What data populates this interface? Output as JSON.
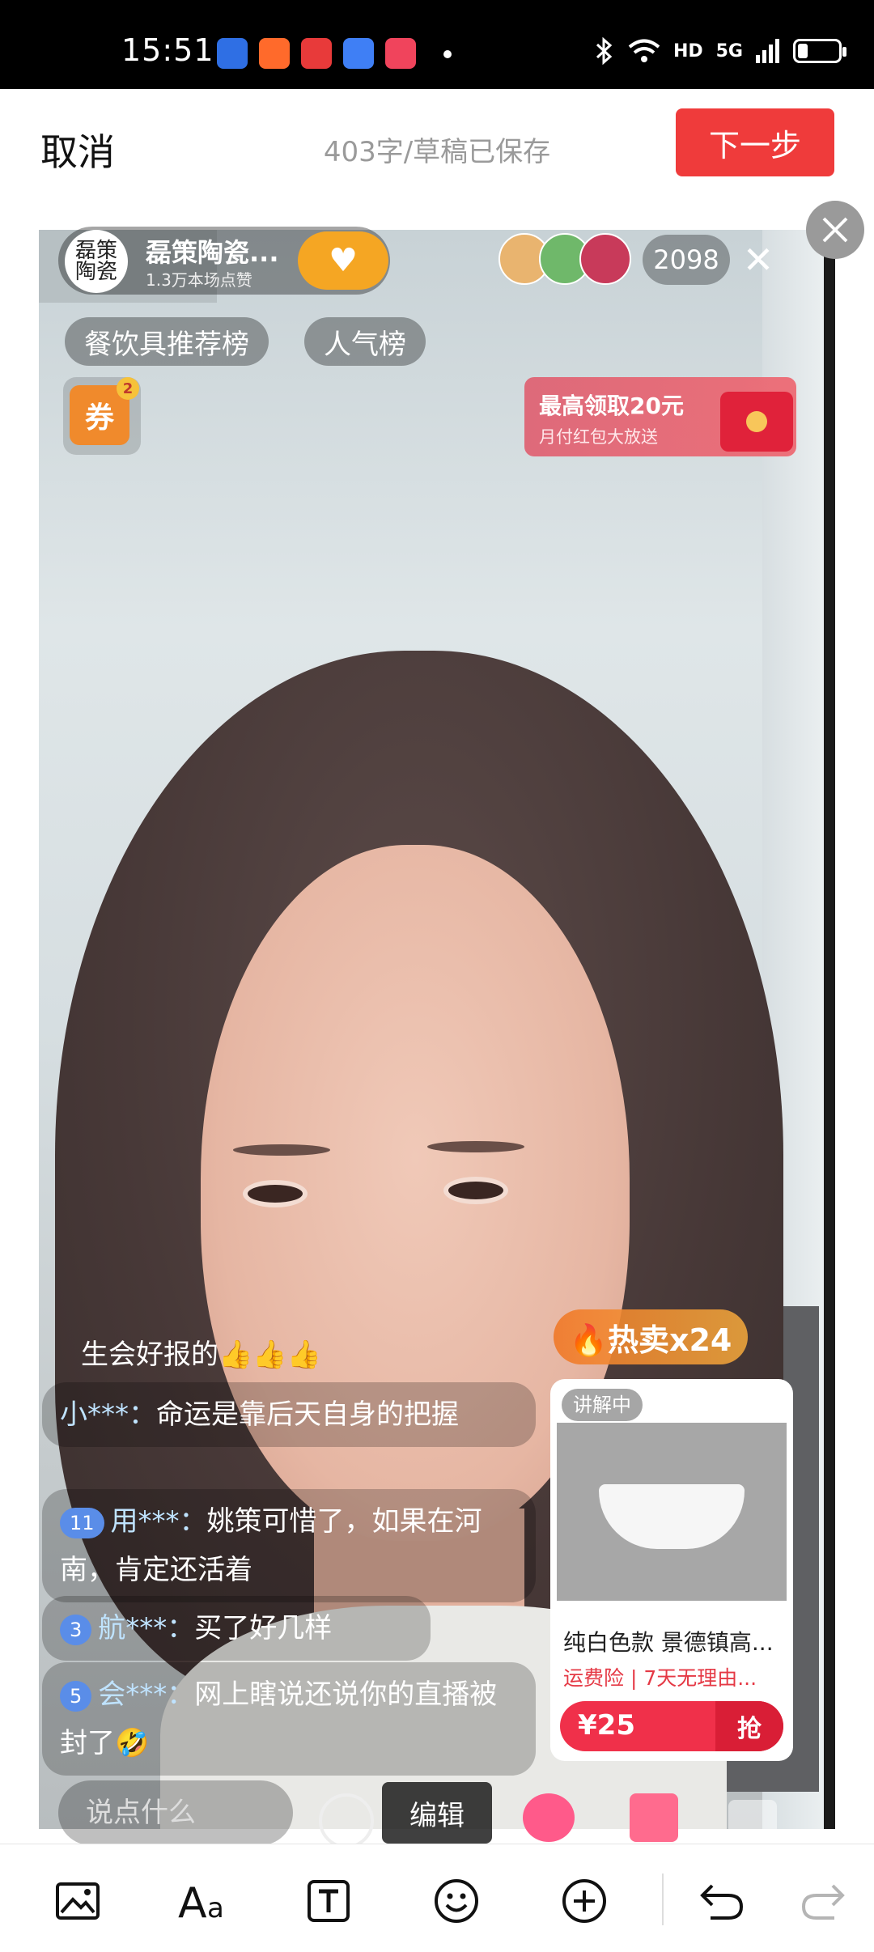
{
  "status_bar": {
    "time": "15:51",
    "apps": [
      {
        "icon": "baidu-app-icon",
        "color": "#2f6fe4"
      },
      {
        "icon": "kuaishou-app-icon",
        "color": "#ff6a2b"
      },
      {
        "icon": "toutiao-app-icon",
        "color": "#e83a3a"
      },
      {
        "icon": "cloud-app-icon",
        "color": "#3f7ff5"
      },
      {
        "icon": "video-app-icon",
        "color": "#f0445c"
      }
    ],
    "indicators": [
      "HD",
      "5G"
    ]
  },
  "topbar": {
    "cancel_label": "取消",
    "draft_status": "403字/草稿已保存",
    "next_label": "下一步"
  },
  "live": {
    "host_name": "磊策陶瓷...",
    "host_avatar_text": "磊策\n陶瓷",
    "host_likes": "1.3万本场点赞",
    "viewer_count": "2098",
    "rank_tags": [
      "餐饮具推荐榜",
      "人气榜"
    ],
    "coupon_label": "券",
    "coupon_count": "2",
    "redpacket_title": "最高领取20元",
    "redpacket_subtitle": "月付红包大放送",
    "comments": [
      {
        "text": "生会好报的👍👍👍"
      },
      {
        "user": "小***：",
        "text": "命运是靠后天自身的把握"
      },
      {
        "badge": "11",
        "user": "用***：",
        "text": "姚策可惜了，如果在河南，肯定还活着"
      },
      {
        "badge": "3",
        "user": "航***：",
        "text": "买了好几样"
      },
      {
        "badge": "5",
        "user": "会***：",
        "text": "网上瞎说还说你的直播被封了🤣"
      }
    ],
    "hot_sale": "🔥热卖x24",
    "product": {
      "explain_label": "讲解中",
      "name": "纯白色款 景德镇高...",
      "tags": "运费险 | 7天无理由...",
      "price": "¥25",
      "grab_label": "抢"
    },
    "say_placeholder": "说点什么",
    "edit_label": "编辑"
  },
  "colors": {
    "accent_red": "#ef3b3b",
    "draft_gray": "#9a9a9a"
  },
  "toolbar": {
    "items": [
      "image-icon",
      "font-icon",
      "text-box-icon",
      "emoji-icon",
      "add-icon",
      "undo-icon",
      "redo-icon"
    ]
  }
}
